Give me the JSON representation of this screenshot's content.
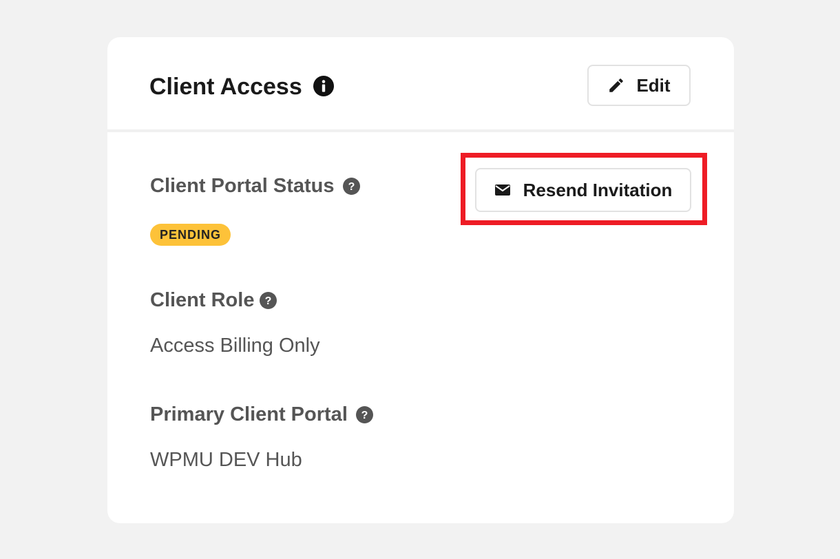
{
  "card": {
    "title": "Client Access",
    "edit_label": "Edit"
  },
  "portal_status": {
    "label": "Client Portal Status",
    "badge": "PENDING"
  },
  "resend": {
    "label": "Resend Invitation"
  },
  "client_role": {
    "label": "Client Role",
    "value": "Access Billing Only"
  },
  "primary_portal": {
    "label": "Primary Client Portal",
    "value": "WPMU DEV Hub"
  },
  "colors": {
    "background": "#f2f2f2",
    "badge": "#fdc239",
    "highlight": "#ee1c25",
    "text_dark": "#1a1a1a",
    "text_muted": "#555555"
  },
  "icons": {
    "title_info": "info-icon",
    "edit": "pencil-icon",
    "resend": "mail-icon",
    "help": "question-icon"
  }
}
